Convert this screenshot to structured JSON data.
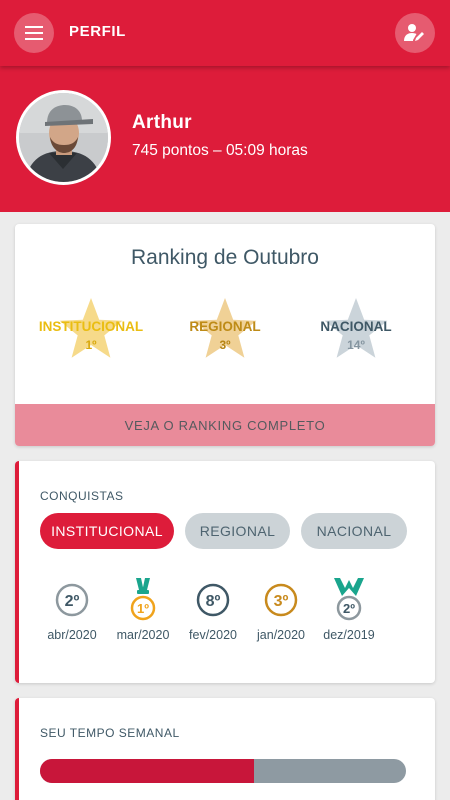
{
  "appbar": {
    "title": "PERFIL",
    "menu_icon": "hamburger-menu-icon",
    "edit_icon": "edit-profile-icon"
  },
  "profile": {
    "name": "Arthur",
    "info": "745 pontos – 05:09 horas"
  },
  "ranking": {
    "title": "Ranking de Outubro",
    "stars": [
      {
        "label": "INSTITUCIONAL",
        "position": "1º",
        "color": "#f6da8a"
      },
      {
        "label": "REGIONAL",
        "position": "3º",
        "color": "#f0d196"
      },
      {
        "label": "NACIONAL",
        "position": "14º",
        "color": "#cbd4da"
      }
    ],
    "button_label": "VEJA O RANKING COMPLETO"
  },
  "conquistas": {
    "label": "CONQUISTAS",
    "tabs": [
      {
        "label": "INSTITUCIONAL",
        "active": true
      },
      {
        "label": "REGIONAL",
        "active": false
      },
      {
        "label": "NACIONAL",
        "active": false
      }
    ],
    "medals": [
      {
        "rank": "2º",
        "date": "abr/2020",
        "color": "#8d989e"
      },
      {
        "rank": "1º",
        "date": "mar/2020",
        "color": "#f0a31c"
      },
      {
        "rank": "8º",
        "date": "fev/2020",
        "color": "#3f5866"
      },
      {
        "rank": "3º",
        "date": "jan/2020",
        "color": "#c88a1d"
      },
      {
        "rank": "2º",
        "date": "dez/2019",
        "color": "#8d989e"
      }
    ]
  },
  "tempo": {
    "label": "SEU TEMPO SEMANAL",
    "progress_fraction": 0.585
  },
  "colors": {
    "primary": "#dd1c3a",
    "ranking_button": "#e98b9a",
    "text_dark": "#3f5866",
    "ribbon_teal": "#1aa58d"
  }
}
